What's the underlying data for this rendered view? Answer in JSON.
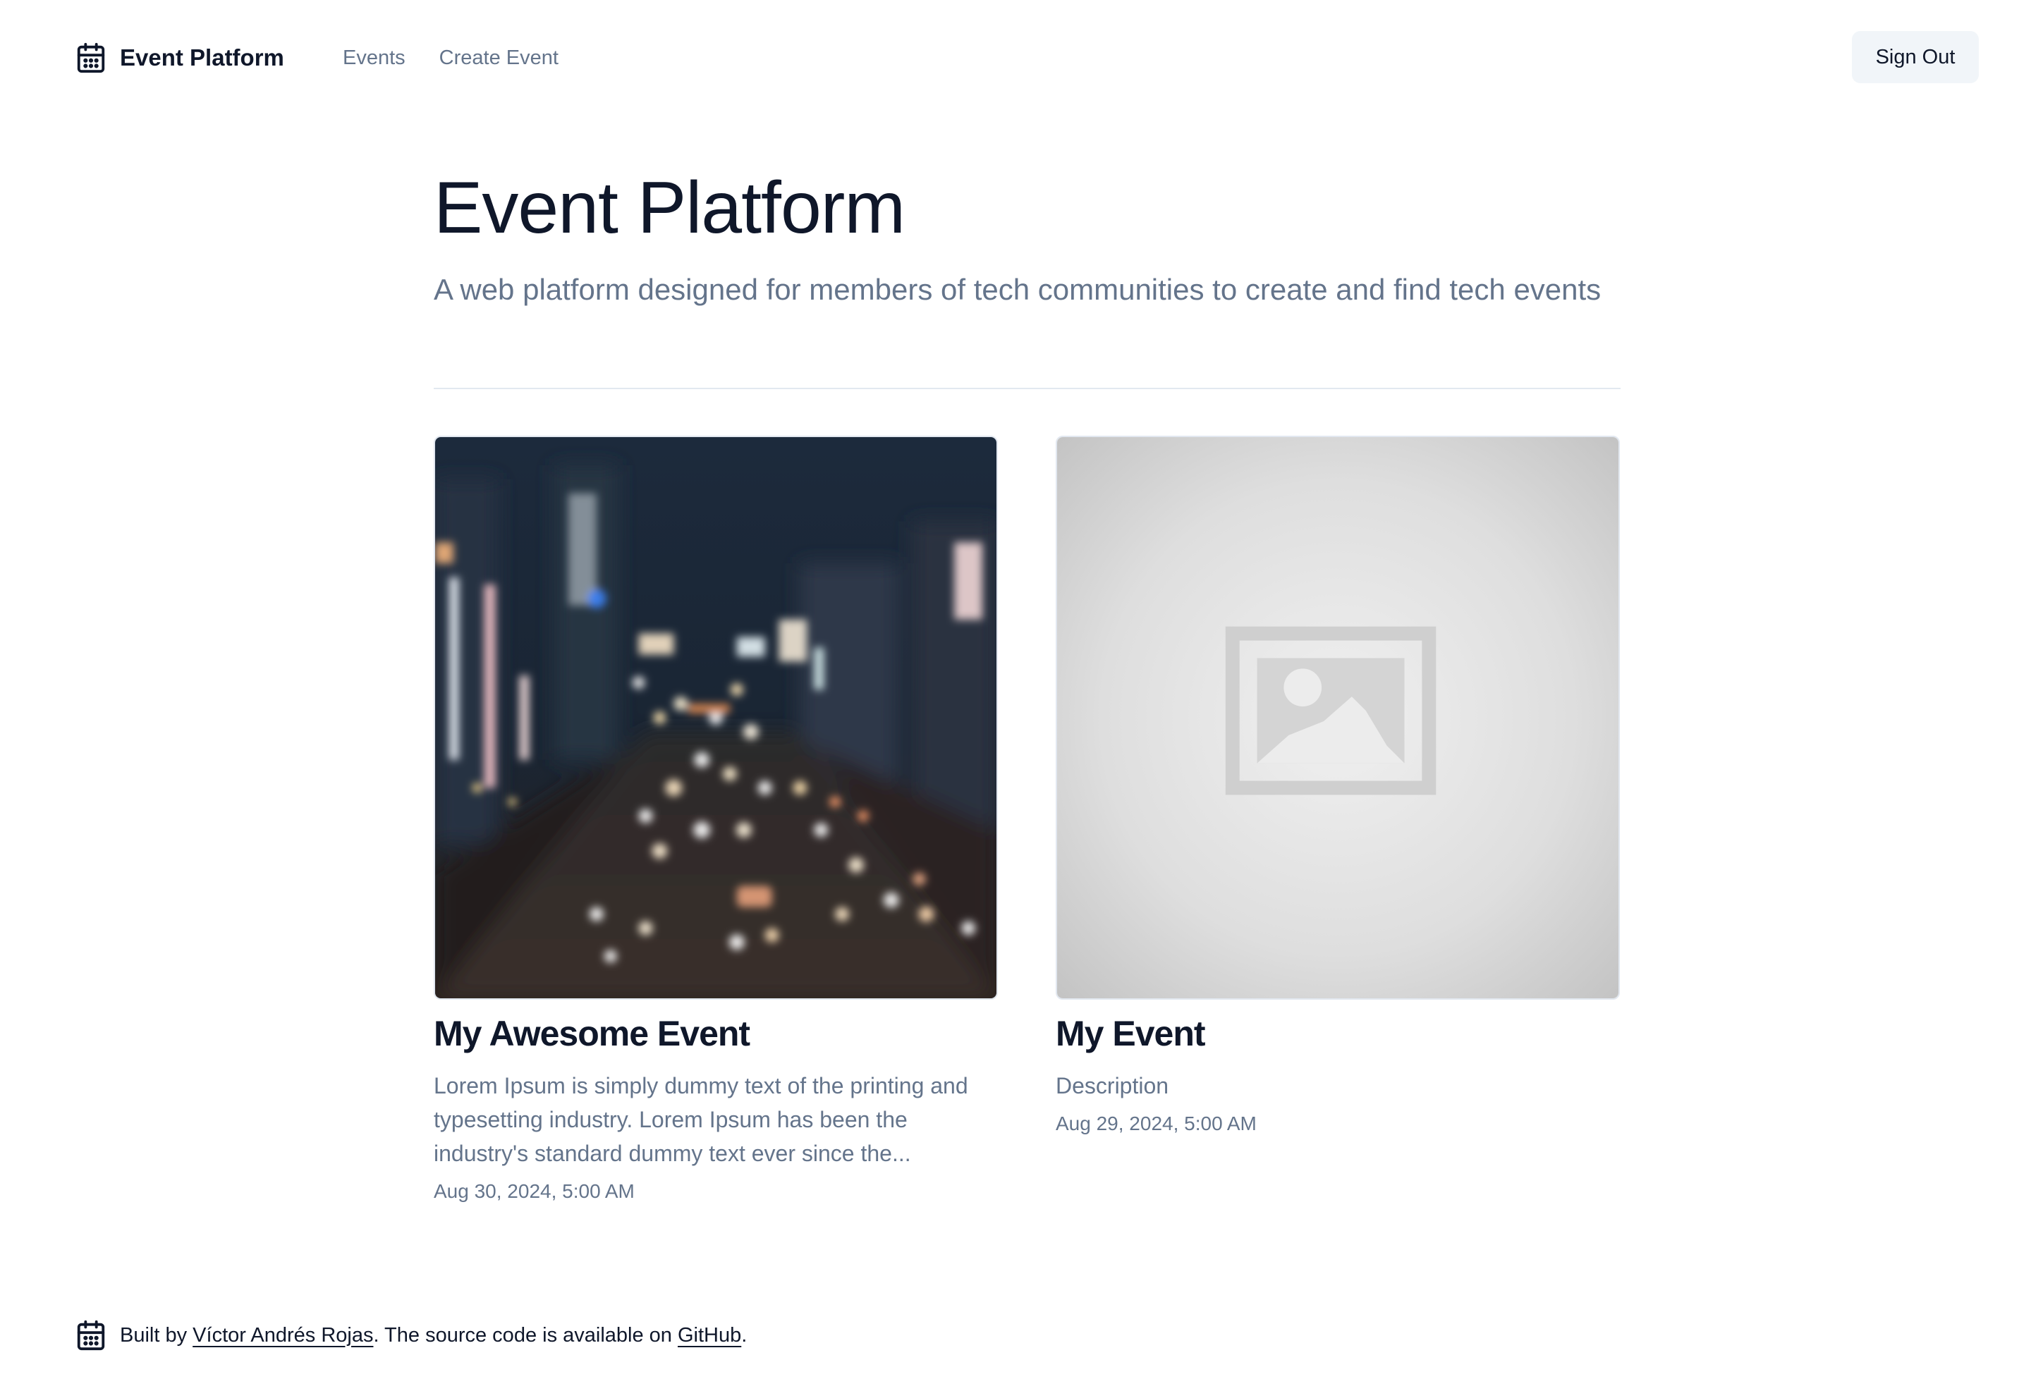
{
  "header": {
    "brand_icon": "calendar-icon",
    "brand_name": "Event Platform",
    "nav": [
      {
        "label": "Events"
      },
      {
        "label": "Create Event"
      }
    ],
    "sign_out_label": "Sign Out"
  },
  "hero": {
    "title": "Event Platform",
    "subtitle": "A web platform designed for members of tech communities to create and find tech events"
  },
  "events": [
    {
      "image": "city-night-traffic-photo",
      "title": "My Awesome Event",
      "description": "Lorem Ipsum is simply dummy text of the printing and typesetting industry. Lorem Ipsum has been the industry's standard dummy text ever since the...",
      "date": "Aug 30, 2024, 5:00 AM"
    },
    {
      "image": "image-placeholder-icon",
      "title": "My Event",
      "description": "Description",
      "date": "Aug 29, 2024, 5:00 AM"
    }
  ],
  "footer": {
    "icon": "calendar-icon",
    "built_by_prefix": "Built by ",
    "author_link": "Víctor Andrés Rojas",
    "middle_text": ". The source code is available on ",
    "github_link": "GitHub",
    "suffix": "."
  },
  "colors": {
    "text": "#0f172a",
    "muted": "#64748b",
    "button_bg": "#f1f5f9",
    "divider": "#e2e8f0"
  }
}
